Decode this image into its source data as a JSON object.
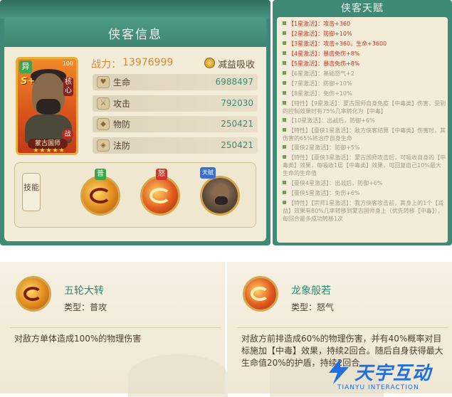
{
  "hero_info": {
    "title": "侠客信息",
    "power_label": "战力：",
    "power_value": "13976999",
    "reduce_absorb": "减益吸收",
    "portrait": {
      "corner_badge": "异",
      "level": "100",
      "grade": "S+",
      "tag": "核心",
      "side_tag": "战",
      "name": "蒙古国师",
      "stars": "★★★★★"
    },
    "stats": [
      {
        "name": "生命",
        "value": "6988497",
        "icon": "heart-icon"
      },
      {
        "name": "攻击",
        "value": "792030",
        "icon": "sword-icon"
      },
      {
        "name": "物防",
        "value": "250421",
        "icon": "shield-icon"
      },
      {
        "name": "法防",
        "value": "250421",
        "icon": "magic-shield-icon"
      }
    ],
    "skills_tab": "技能",
    "skill_badges": [
      {
        "text": "普",
        "color": "#3fa54b"
      },
      {
        "text": "怒",
        "color": "#d0362a"
      },
      {
        "text": "天赋",
        "color": "#3a6fd0"
      }
    ]
  },
  "talent": {
    "title": "侠客天赋",
    "lines": [
      {
        "key": "【1星激活】：",
        "effect": "攻击+360",
        "state": "on"
      },
      {
        "key": "【2星激活】：",
        "effect": "防御+10%",
        "state": "on"
      },
      {
        "key": "【3星激活】：",
        "effect": "攻击+360，生命+3600",
        "state": "on"
      },
      {
        "key": "【4星激活】：",
        "effect": "暴击免伤+8%",
        "state": "on"
      },
      {
        "key": "【5星激活】：",
        "effect": "暴击免伤+8%",
        "state": "on"
      },
      {
        "key": "【6星激活】：",
        "effect": "基础怒气+2",
        "state": "off"
      },
      {
        "key": "【7星激活】：",
        "effect": "防御+10%",
        "state": "off"
      },
      {
        "key": "【8星激活】：",
        "effect": "免伤+10%",
        "state": "off"
      },
      {
        "key": "【特性】【9星激活】：",
        "effect": "蒙古国师自身免疫【中毒类】伤害，受到的控制效果时有75%几率转化为【中毒】",
        "state": "off"
      },
      {
        "key": "【10星激活】：",
        "effect": "出战后，防御+6%",
        "state": "off"
      },
      {
        "key": "【特性】【豪侠1星激活】：",
        "effect": "敌方侠客结算【中毒类】伤害时，其伤害的65%将治疗自身生命",
        "state": "off"
      },
      {
        "key": "【豪侠2星激活】：",
        "effect": "防御+5%",
        "state": "off"
      },
      {
        "key": "【特性】【豪侠3星激活】：",
        "effect": "蒙古国师攻击后，可吸收自身的【中毒类】效果，每吸收1层【中毒类】效果，可回复自己10%最大生命的生命值",
        "state": "off"
      },
      {
        "key": "【豪侠4星激活】：",
        "effect": "出战后，防御+6%",
        "state": "off"
      },
      {
        "key": "【豪侠5星激活】：",
        "effect": "免伤+6%",
        "state": "off"
      },
      {
        "key": "【特性】【宗师1星激活】：",
        "effect": "我方侠客攻击前，其身上的1个【减益】效果有80%几率转移到蒙古国师身上（优先转移【中毒】），每回合最多成功转移1次",
        "state": "off"
      }
    ]
  },
  "cards": [
    {
      "name": "五轮大转",
      "type_label": "类型：",
      "type_value": "普攻",
      "description": "对敌方单体造成100%的物理伤害"
    },
    {
      "name": "龙象般若",
      "type_label": "类型：",
      "type_value": "怒气",
      "description": "对敌方前排造成60%的物理伤害，并有40%概率对目标施加【中毒】效果，持续2回合。随后自身获得最大生命值20%的护盾，持续2回合"
    }
  ],
  "watermark": {
    "text": "天宇互动",
    "sub": "TIANYU INTERACTION"
  },
  "colors": {
    "panel_green": "#3e8a76",
    "parchment": "#f3ecd8",
    "active_red": "#d0362a",
    "power_orange": "#d8892f",
    "value_green": "#3f8a74"
  }
}
